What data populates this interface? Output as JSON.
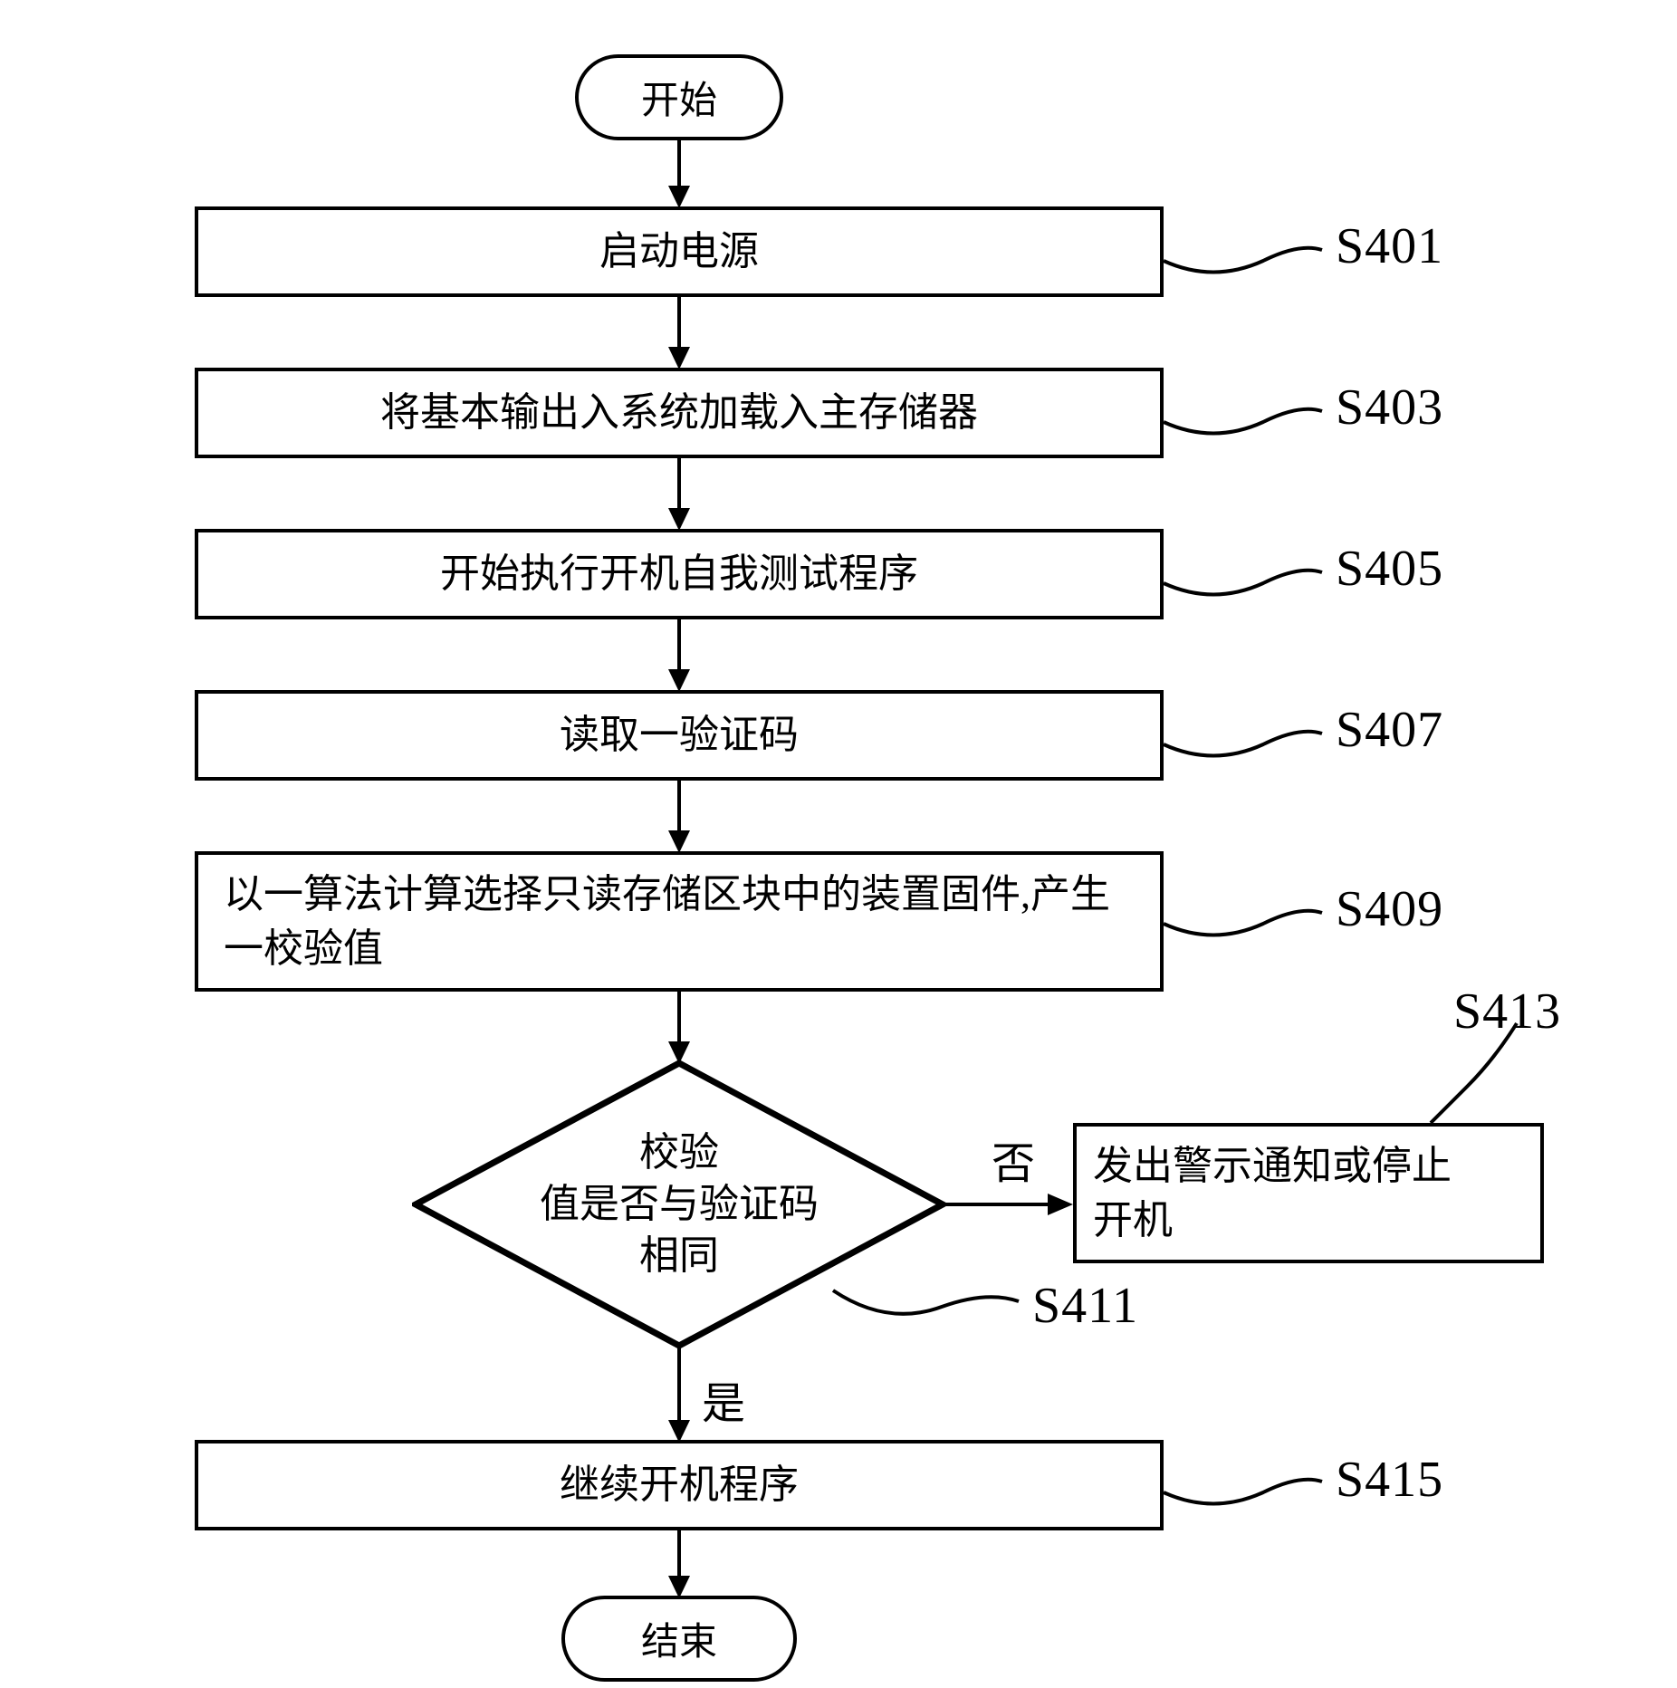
{
  "terminator": {
    "start": "开始",
    "end": "结束"
  },
  "steps": {
    "s401": {
      "label": "S401",
      "text": "启动电源"
    },
    "s403": {
      "label": "S403",
      "text": "将基本输出入系统加载入主存储器"
    },
    "s405": {
      "label": "S405",
      "text": "开始执行开机自我测试程序"
    },
    "s407": {
      "label": "S407",
      "text": "读取一验证码"
    },
    "s409": {
      "label": "S409",
      "text": "以一算法计算选择只读存储区块中的装置固件,产生一校验值"
    },
    "s411": {
      "label": "S411",
      "line1": "校验",
      "line2": "值是否与验证码",
      "line3": "相同"
    },
    "s413": {
      "label": "S413",
      "line1": "发出警示通知或停止",
      "line2": "开机"
    },
    "s415": {
      "label": "S415",
      "text": "继续开机程序"
    }
  },
  "branches": {
    "no": "否",
    "yes": "是"
  },
  "chart_data": {
    "type": "flowchart",
    "title": "",
    "nodes": [
      {
        "id": "start",
        "kind": "terminator",
        "label": "开始"
      },
      {
        "id": "S401",
        "kind": "process",
        "label": "启动电源"
      },
      {
        "id": "S403",
        "kind": "process",
        "label": "将基本输出入系统加载入主存储器"
      },
      {
        "id": "S405",
        "kind": "process",
        "label": "开始执行开机自我测试程序"
      },
      {
        "id": "S407",
        "kind": "process",
        "label": "读取一验证码"
      },
      {
        "id": "S409",
        "kind": "process",
        "label": "以一算法计算选择只读存储区块中的装置固件,产生一校验值"
      },
      {
        "id": "S411",
        "kind": "decision",
        "label": "校验值是否与验证码相同"
      },
      {
        "id": "S413",
        "kind": "process",
        "label": "发出警示通知或停止开机"
      },
      {
        "id": "S415",
        "kind": "process",
        "label": "继续开机程序"
      },
      {
        "id": "end",
        "kind": "terminator",
        "label": "结束"
      }
    ],
    "edges": [
      {
        "from": "start",
        "to": "S401"
      },
      {
        "from": "S401",
        "to": "S403"
      },
      {
        "from": "S403",
        "to": "S405"
      },
      {
        "from": "S405",
        "to": "S407"
      },
      {
        "from": "S407",
        "to": "S409"
      },
      {
        "from": "S409",
        "to": "S411"
      },
      {
        "from": "S411",
        "to": "S413",
        "label": "否"
      },
      {
        "from": "S411",
        "to": "S415",
        "label": "是"
      },
      {
        "from": "S415",
        "to": "end"
      }
    ]
  }
}
